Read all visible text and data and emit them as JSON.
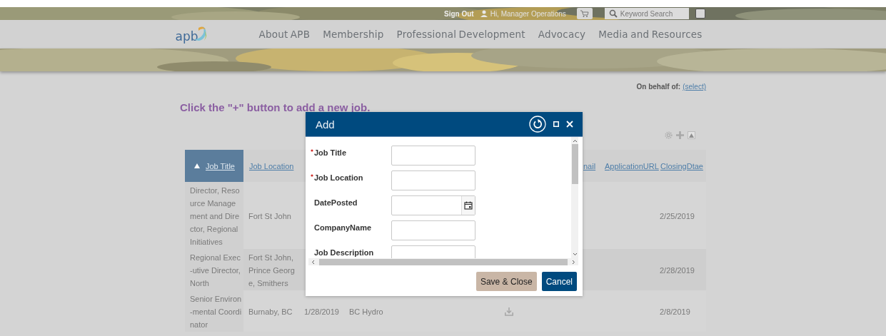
{
  "top_bar": {
    "sign_out": "Sign Out",
    "greeting": "Hi, Manager Operations",
    "search": {
      "placeholder": "Keyword Search"
    }
  },
  "nav": {
    "logo": "apb",
    "items": [
      "About APB",
      "Membership",
      "Professional Development",
      "Advocacy",
      "Media and Resources"
    ]
  },
  "on_behalf": {
    "label": "On behalf of:",
    "link": "(select)"
  },
  "instruction": "Click the \"+\" button to add a new job.",
  "table": {
    "columns": [
      {
        "label": "Job Title",
        "sorted": true
      },
      {
        "label": "Job Location",
        "sorted": false
      },
      {},
      {},
      {},
      {},
      {
        "label": "nail",
        "sorted": false
      },
      {
        "label": "ApplicationURL",
        "sorted": false
      },
      {
        "label": "ClosingDtae",
        "sorted": false
      }
    ],
    "rows": [
      {
        "cells": [
          "Director, Resource Management and Director, Regional Initiatives",
          "Fort St John",
          null,
          null,
          null,
          null,
          null,
          null,
          "2/25/2019"
        ]
      },
      {
        "cells": [
          "Regional Exec-utive Director, North",
          "Fort St John, Prince George, Smithers",
          null,
          null,
          null,
          null,
          null,
          null,
          "2/28/2019"
        ]
      },
      {
        "cells": [
          "Senior Environ-mental Coordinator",
          "Burnaby, BC",
          "1/28/2019",
          "BC Hydro",
          null,
          {
            "kind": "download"
          },
          null,
          null,
          "2/8/2019"
        ]
      }
    ]
  },
  "dialog": {
    "title": "Add",
    "fields": [
      {
        "label": "Job Title",
        "required": true,
        "kind": "text"
      },
      {
        "label": "Job Location",
        "required": true,
        "kind": "text"
      },
      {
        "label": "DatePosted",
        "required": false,
        "kind": "date"
      },
      {
        "label": "CompanyName",
        "required": false,
        "kind": "text"
      },
      {
        "label": "Job Description",
        "required": false,
        "kind": "text"
      }
    ],
    "buttons": [
      {
        "label": "Save & Close",
        "kind": "secondary"
      },
      {
        "label": "Cancel",
        "kind": "primary"
      }
    ]
  }
}
